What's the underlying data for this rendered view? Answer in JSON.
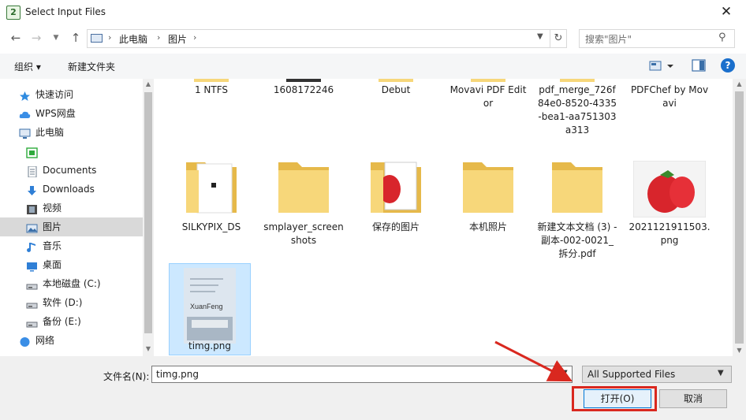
{
  "window": {
    "title": "Select Input Files",
    "close_glyph": "✕",
    "app_icon_text": "2"
  },
  "address": {
    "crumbs": [
      "此电脑",
      "图片"
    ],
    "separator": "›",
    "search_placeholder": "搜索\"图片\""
  },
  "toolbar": {
    "organize_label": "组织 ▾",
    "newfolder_label": "新建文件夹",
    "help_label": "?"
  },
  "sidebar": {
    "items": [
      {
        "label": "快速访问",
        "icon": "star-icon",
        "indent": 0
      },
      {
        "label": "WPS网盘",
        "icon": "cloud-icon",
        "indent": 0
      },
      {
        "label": "此电脑",
        "icon": "computer-icon",
        "indent": 0
      },
      {
        "label": "",
        "icon": "green-app-icon",
        "indent": 1
      },
      {
        "label": "Documents",
        "icon": "document-icon",
        "indent": 1
      },
      {
        "label": "Downloads",
        "icon": "download-icon",
        "indent": 1
      },
      {
        "label": "视频",
        "icon": "video-icon",
        "indent": 1
      },
      {
        "label": "图片",
        "icon": "picture-icon",
        "indent": 1,
        "selected": true
      },
      {
        "label": "音乐",
        "icon": "music-icon",
        "indent": 1
      },
      {
        "label": "桌面",
        "icon": "desktop-icon",
        "indent": 1
      },
      {
        "label": "本地磁盘 (C:)",
        "icon": "drive-icon",
        "indent": 1
      },
      {
        "label": "软件 (D:)",
        "icon": "drive-icon",
        "indent": 1
      },
      {
        "label": "备份 (E:)",
        "icon": "drive-icon",
        "indent": 1
      },
      {
        "label": "网络",
        "icon": "network-icon",
        "indent": 0
      }
    ]
  },
  "files": {
    "row1": [
      {
        "name": "1 NTFS"
      },
      {
        "name": "1608172246"
      },
      {
        "name": "Debut"
      },
      {
        "name": "Movavi PDF Editor"
      },
      {
        "name": "pdf_merge_726f84e0-8520-4335-bea1-aa751303a313"
      },
      {
        "name": "PDFChef by Movavi"
      }
    ],
    "row2": [
      {
        "name": "SILKYPIX_DS",
        "kind": "folder-doc"
      },
      {
        "name": "smplayer_screenshots",
        "kind": "folder"
      },
      {
        "name": "保存的图片",
        "kind": "folder-strawberry"
      },
      {
        "name": "本机照片",
        "kind": "folder"
      },
      {
        "name": "新建文本文档 (3) - 副本-002-0021_拆分.pdf",
        "kind": "folder"
      },
      {
        "name": "2021121911503.png",
        "kind": "image-strawberry"
      }
    ],
    "row3": [
      {
        "name": "timg.png",
        "kind": "image-book",
        "selected": true,
        "thumb_title": "XuanFeng"
      }
    ]
  },
  "bottom": {
    "filename_label": "文件名(N):",
    "filename_value": "timg.png",
    "filetype_value": "All Supported Files",
    "open_label": "打开(O)",
    "cancel_label": "取消"
  },
  "colors": {
    "selection": "#cce8ff",
    "accent": "#0078d7",
    "annotation_red": "#d9281f",
    "folder": "#f7d77a"
  }
}
